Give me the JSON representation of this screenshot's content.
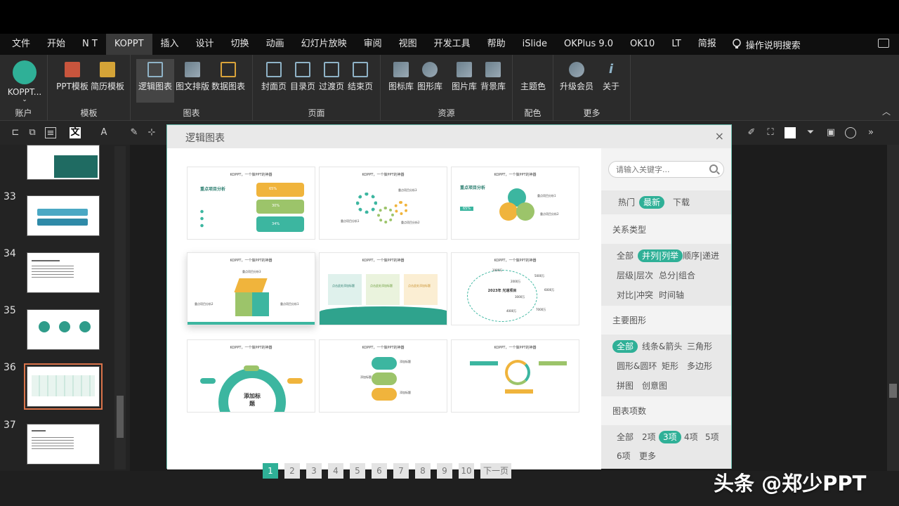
{
  "menubar": {
    "tabs": [
      "文件",
      "开始",
      "N T",
      "KOPPT",
      "插入",
      "设计",
      "切换",
      "动画",
      "幻灯片放映",
      "审阅",
      "视图",
      "开发工具",
      "帮助",
      "iSlide",
      "OKPlus 9.0",
      "OK10",
      "LT",
      "简报"
    ],
    "active_tab": "KOPPT",
    "search_label": "操作说明搜索"
  },
  "ribbon": {
    "account": {
      "label": "KOPPT...",
      "group": "账户"
    },
    "template": {
      "items": [
        "PPT模板",
        "简历模板"
      ],
      "group": "模板"
    },
    "chart": {
      "items": [
        "逻辑图表",
        "图文排版",
        "数据图表"
      ],
      "group": "图表"
    },
    "page": {
      "items": [
        "封面页",
        "目录页",
        "过渡页",
        "结束页"
      ],
      "group": "页面"
    },
    "resource": {
      "items": [
        "图标库",
        "图形库",
        "图片库",
        "背景库"
      ],
      "group": "资源"
    },
    "color": {
      "items": [
        "主题色"
      ],
      "group": "配色"
    },
    "more": {
      "items": [
        "升级会员",
        "关于"
      ],
      "group": "更多"
    }
  },
  "slides": {
    "numbers": [
      "33",
      "34",
      "35",
      "36",
      "37"
    ],
    "selected": "36"
  },
  "dialog": {
    "title": "逻辑图表",
    "close": "×",
    "cards": [
      {
        "title": "KOPPT，一个做PPT的神器",
        "heading": "重点项目分析",
        "pcts": [
          "65%",
          "30%",
          "34%"
        ]
      },
      {
        "title": "KOPPT，一个做PPT的神器",
        "labels": [
          "重点项目分析1",
          "重点项目分析2",
          "重点项目分析3"
        ]
      },
      {
        "title": "KOPPT，一个做PPT的神器",
        "heading": "重点项目分析",
        "pct": "65%",
        "labels": [
          "重点项目分析1",
          "重点项目分析2"
        ]
      },
      {
        "title": "KOPPT，一个做PPT的神器",
        "labels": [
          "重点项目分析3",
          "重点项目分析2",
          "重点项目分析1"
        ]
      },
      {
        "title": "KOPPT，一个做PPT的神器",
        "labels": [
          "点击此处添加标题",
          "点击此处添加标题",
          "点击此处添加标题"
        ]
      },
      {
        "title": "KOPPT，一个做PPT的神器",
        "center": "2023年 光速项目",
        "values": [
          "1000万",
          "2000万",
          "3000万",
          "4000万",
          "5000万",
          "6000万",
          "7000万"
        ]
      },
      {
        "title": "KOPPT，一个做PPT的神器",
        "center": "添加标题"
      },
      {
        "title": "KOPPT，一个做PPT的神器",
        "labels": [
          "添加标题",
          "添加标题",
          "添加标题"
        ]
      },
      {
        "title": "KOPPT，一个做PPT的神器"
      }
    ],
    "pager": {
      "pages": [
        "1",
        "2",
        "3",
        "4",
        "5",
        "6",
        "7",
        "8",
        "9",
        "10"
      ],
      "active": "1",
      "next": "下一页"
    },
    "sidebar": {
      "search_placeholder": "请输入关键字...",
      "sort": {
        "items": [
          "热门",
          "最新",
          "下载"
        ],
        "active": "最新"
      },
      "relation": {
        "head": "关系类型",
        "items": [
          "全部",
          "并列|列举",
          "顺序|递进",
          "层级|层次",
          "总分|组合",
          "对比|冲突",
          "时间轴"
        ],
        "active": "并列|列举"
      },
      "shape": {
        "head": "主要图形",
        "items": [
          "全部",
          "线条&箭头",
          "三角形",
          "圆形&圆环",
          "矩形",
          "多边形",
          "拼图",
          "创意图"
        ],
        "active": "全部"
      },
      "count": {
        "head": "图表项数",
        "items": [
          "全部",
          "2项",
          "3项",
          "4项",
          "5项",
          "6项",
          "更多"
        ],
        "active": "3项"
      }
    }
  },
  "watermark": "头条 @郑少PPT",
  "colors": {
    "accent": "#2fb097",
    "yellow": "#f0b43c",
    "green": "#9cc46a",
    "teal": "#3cb6a0"
  }
}
